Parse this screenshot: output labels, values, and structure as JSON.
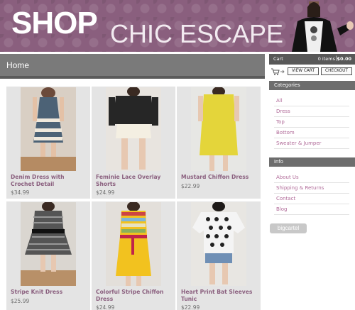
{
  "header": {
    "shop_word": "SHOP",
    "brand_name": "CHIC ESCAPE",
    "banner_color": "#8a5f7e"
  },
  "page": {
    "title": "Home"
  },
  "products": [
    {
      "name": "Denim Dress with Crochet Detail",
      "price": "$34.99",
      "photo_icon": "denim-dress-photo"
    },
    {
      "name": "Feminie Lace Overlay Shorts",
      "price": "$24.99",
      "photo_icon": "lace-shorts-photo"
    },
    {
      "name": "Mustard Chiffon Dress",
      "price": "$22.99",
      "photo_icon": "mustard-dress-photo"
    },
    {
      "name": "Stripe Knit Dress",
      "price": "$25.99",
      "photo_icon": "stripe-knit-dress-photo"
    },
    {
      "name": "Colorful Stripe Chiffon Dress",
      "price": "$24.99",
      "photo_icon": "colorful-stripe-dress-photo"
    },
    {
      "name": "Heart Print Bat Sleeves Tunic",
      "price": "$22.99",
      "photo_icon": "heart-tunic-photo"
    }
  ],
  "cart": {
    "label": "Cart",
    "items": "0 items",
    "separator": "|",
    "total": "$0.00",
    "view_cart_label": "VIEW CART",
    "checkout_label": "CHECKOUT"
  },
  "sidebar": {
    "categories_title": "Categories",
    "categories": [
      "All",
      "Dress",
      "Top",
      "Bottom",
      "Sweater & Jumper"
    ],
    "info_title": "Info",
    "info_links": [
      "About Us",
      "Shipping & Returns",
      "Contact",
      "Blog"
    ],
    "badge_label": "bigcartel"
  },
  "colors": {
    "link": "#b06a98",
    "product_name": "#8a5f7e",
    "bar_dark": "#585858",
    "bar_mid": "#6d6d6d"
  }
}
